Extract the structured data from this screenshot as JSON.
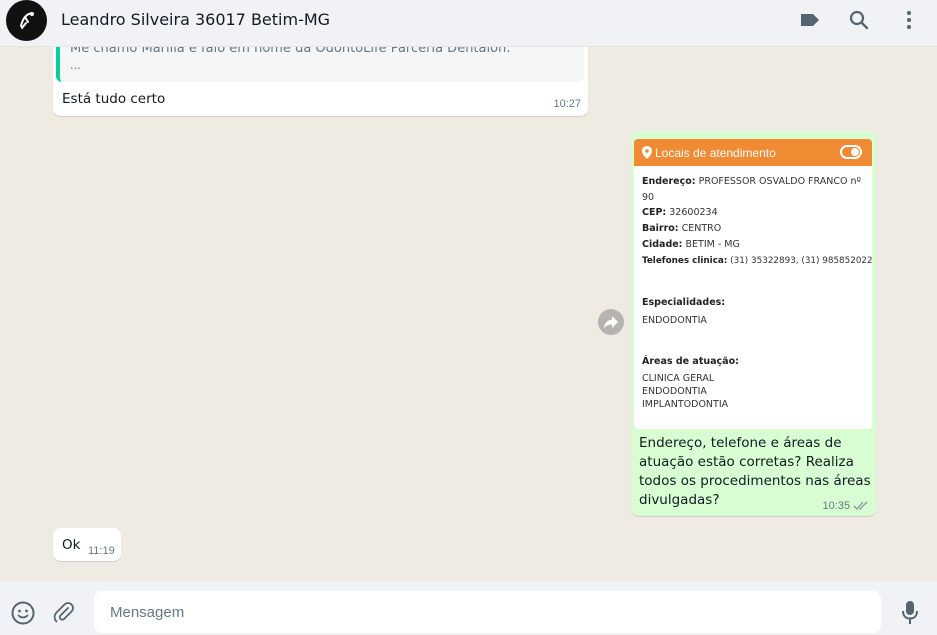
{
  "header": {
    "contact_name": "Leandro Silveira 36017 Betim-MG",
    "icons": [
      "label-icon",
      "search-icon",
      "menu-icon"
    ]
  },
  "messages": {
    "quoted": {
      "line1": "Me chamo Marilia e falo em nome da OdontoLife Parceria Dentalon:",
      "line2": "..."
    },
    "msg1": {
      "text": "Está tudo certo",
      "time": "10:27"
    },
    "card": {
      "title": "Locais de atendimento",
      "endereco_label": "Endereço:",
      "endereco_value": "PROFESSOR OSVALDO FRANCO nº",
      "endereco_cont": "90",
      "cep_label": "CEP:",
      "cep_value": "32600234",
      "bairro_label": "Bairro:",
      "bairro_value": "CENTRO",
      "cidade_label": "Cidade:",
      "cidade_value": "BETIM - MG",
      "telefones_label": "Telefones clinica:",
      "telefones_value": "(31) 35322893, (31) 985852022",
      "especialidades_label": "Especialidades:",
      "especialidades": [
        "ENDODONTIA"
      ],
      "areas_label": "Áreas de atuação:",
      "areas": [
        "CLINICA GERAL",
        "ENDODONTIA",
        "IMPLANTODONTIA"
      ]
    },
    "msg2": {
      "line1": "Endereço, telefone e áreas de",
      "line2": "atuação estão corretas? Realiza",
      "line3": "todos os procedimentos nas áreas",
      "line4": "divulgadas?",
      "time": "10:35"
    },
    "msg3": {
      "text": "Ok",
      "time": "11:19"
    }
  },
  "footer": {
    "placeholder": "Mensagem",
    "icons": [
      "emoji-icon",
      "attach-icon",
      "mic-icon"
    ]
  },
  "colors": {
    "accent_orange": "#f08a33",
    "outgoing_bubble": "#d9fdd3",
    "incoming_bubble": "#ffffff",
    "quote_bar": "#06cf9c"
  }
}
